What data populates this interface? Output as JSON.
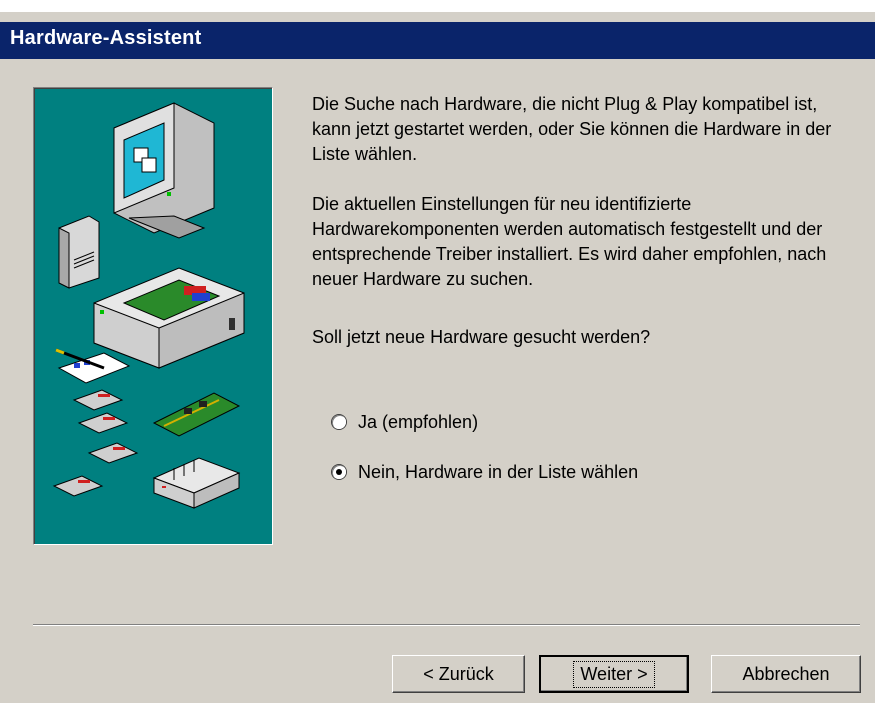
{
  "window": {
    "title": "Hardware-Assistent"
  },
  "content": {
    "paragraph1": "Die Suche nach Hardware, die nicht Plug & Play kompatibel ist, kann jetzt gestartet werden, oder Sie können die Hardware in der Liste wählen.",
    "paragraph2": "Die aktuellen Einstellungen für neu identifizierte Hardwarekomponenten werden automatisch festgestellt und der entsprechende Treiber installiert. Es wird daher empfohlen, nach neuer Hardware zu suchen.",
    "question": "Soll jetzt neue Hardware gesucht werden?"
  },
  "options": [
    {
      "label": "Ja (empfohlen)",
      "selected": false
    },
    {
      "label": "Nein, Hardware in der Liste wählen",
      "selected": true
    }
  ],
  "buttons": {
    "back": "< Zurück",
    "next": "Weiter >",
    "cancel": "Abbrechen"
  },
  "colors": {
    "titlebar": "#0a246a",
    "dialog": "#d4d0c8",
    "graphic_bg": "#008080"
  },
  "icons": [
    "monitor-icon",
    "modem-icon",
    "computer-case-icon",
    "pen-document-icon",
    "floppy-disk-icon",
    "expansion-card-icon",
    "hub-icon"
  ]
}
